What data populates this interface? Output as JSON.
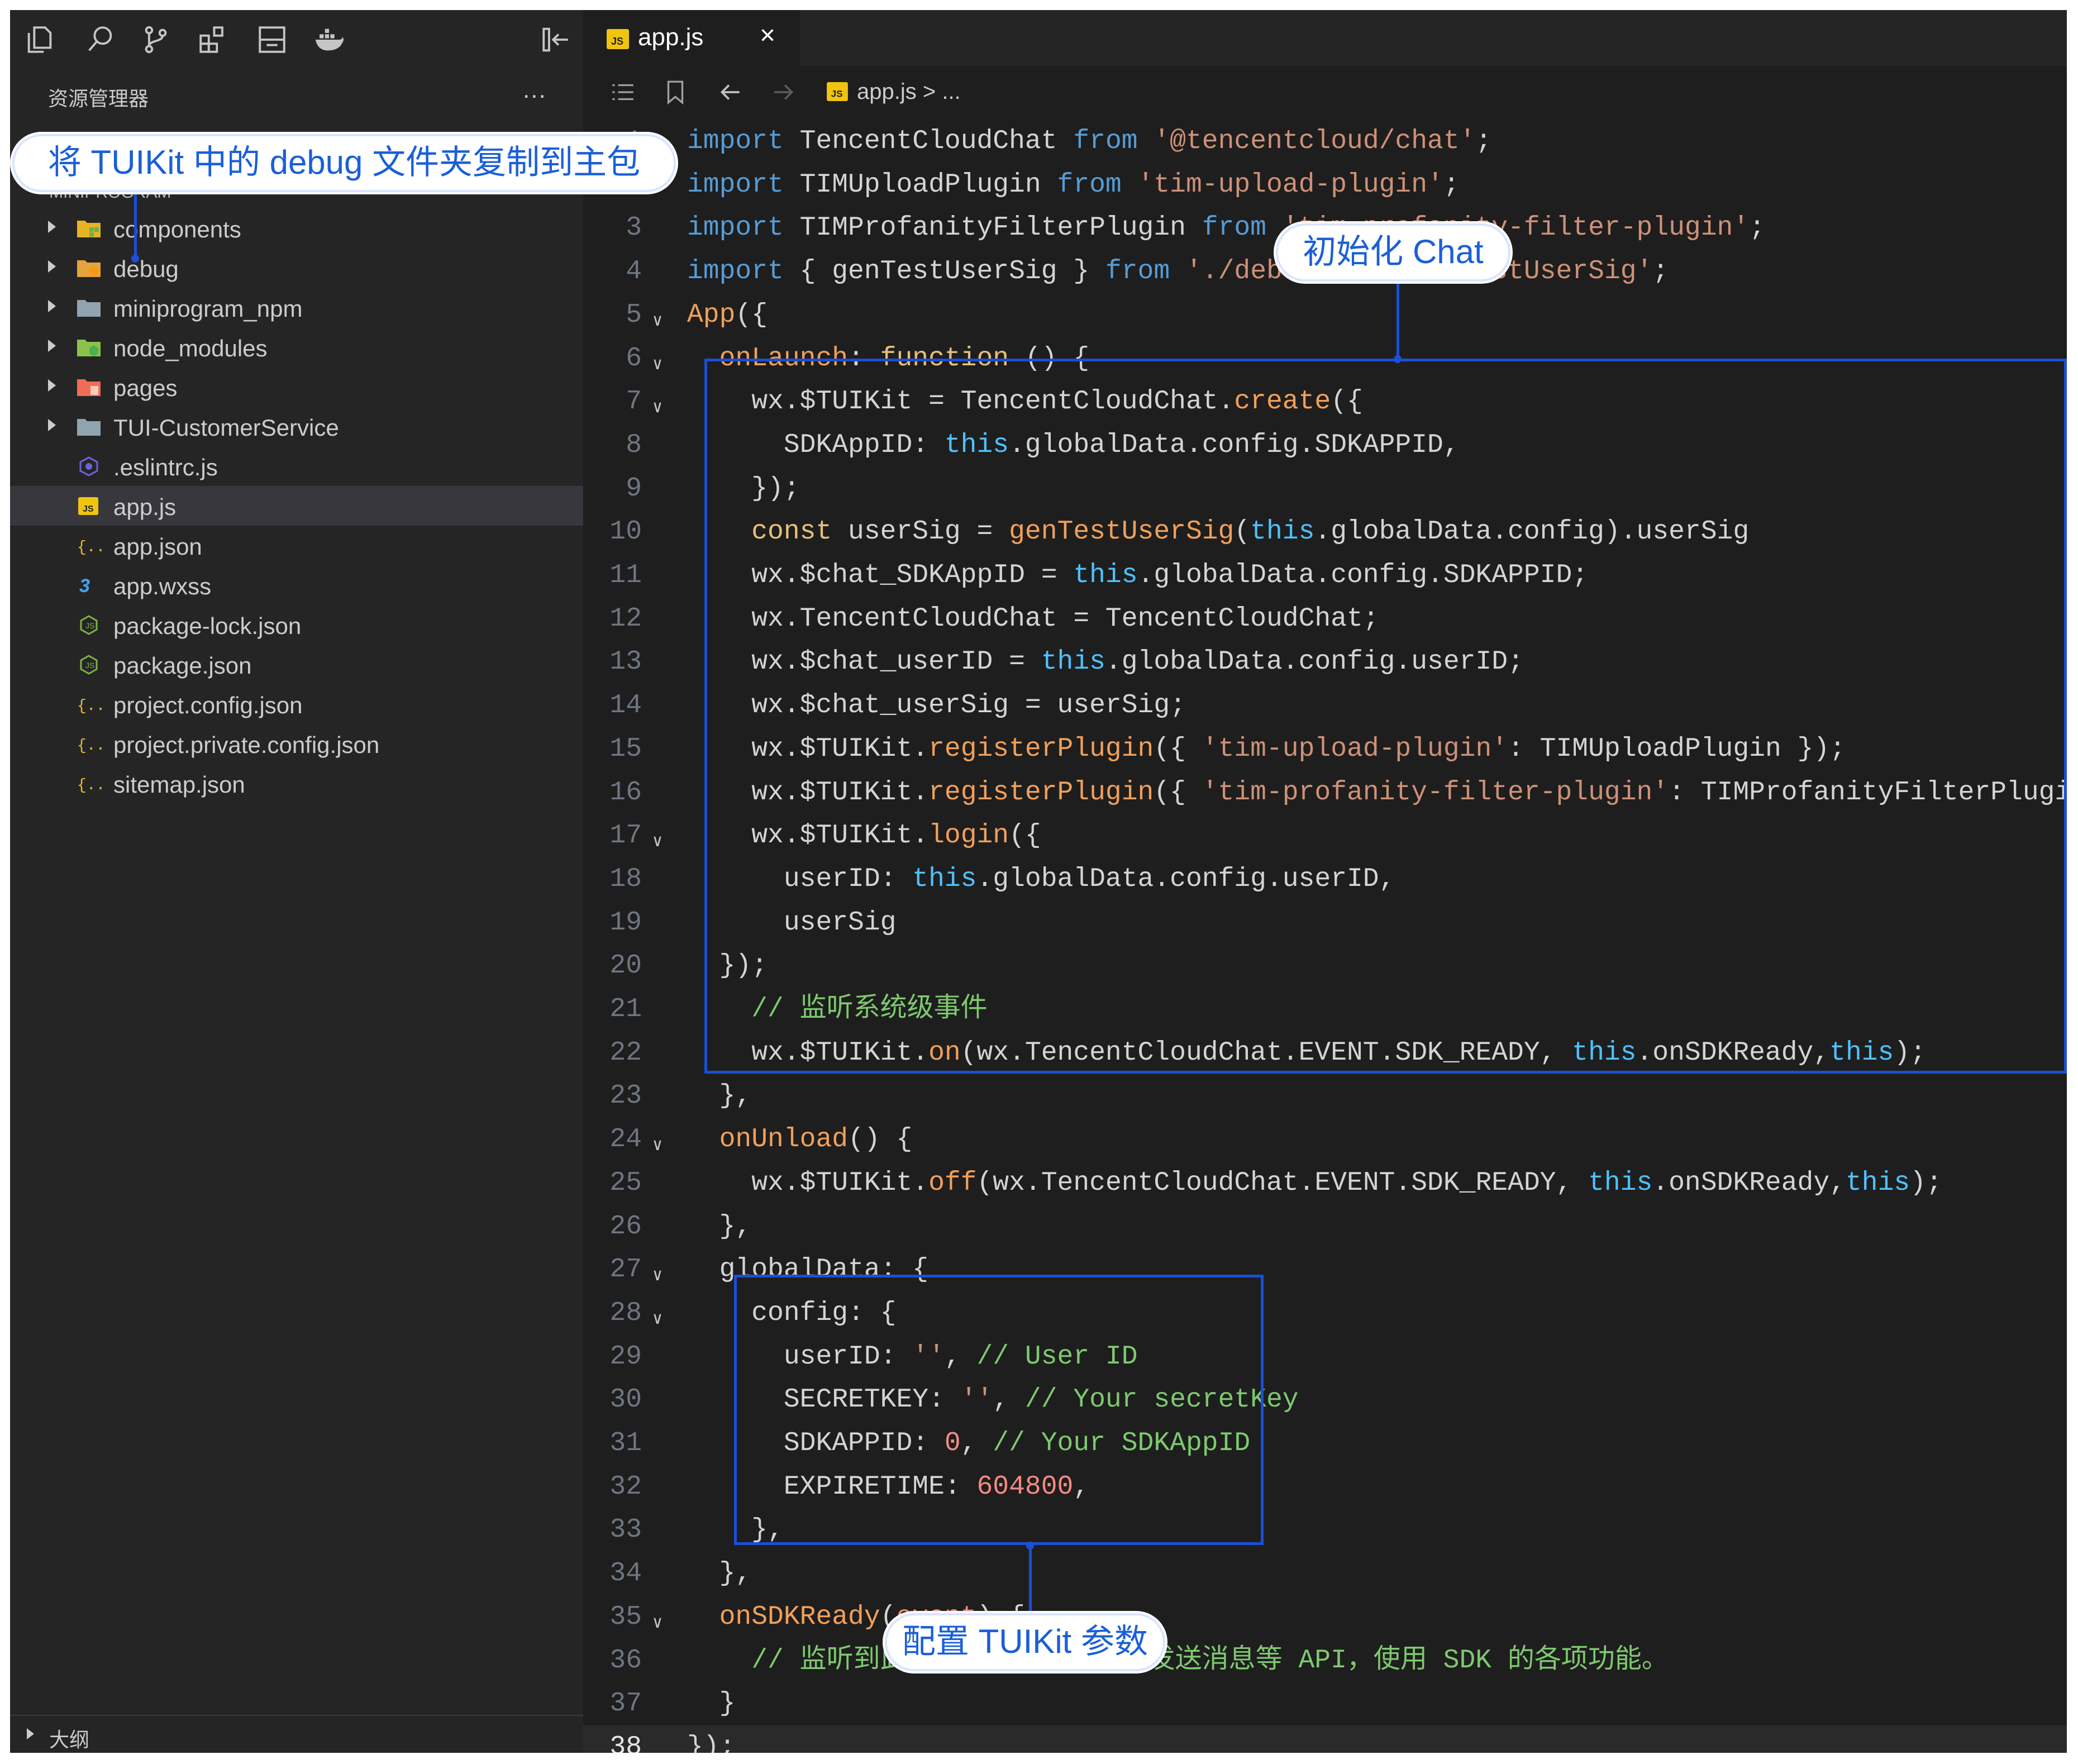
{
  "activity_icons": [
    "files-icon",
    "search-icon",
    "source-control-icon",
    "extensions-icon",
    "panel-icon",
    "docker-icon",
    "collapse-panel-icon"
  ],
  "explorer": {
    "title": "资源管理器",
    "more": "...",
    "section": "MINIPROGRAM",
    "items": [
      {
        "label": "components",
        "type": "folder",
        "icon": "components-folder-icon",
        "expandable": true
      },
      {
        "label": "debug",
        "type": "folder",
        "icon": "debug-folder-icon",
        "expandable": true
      },
      {
        "label": "miniprogram_npm",
        "type": "folder",
        "icon": "folder-icon",
        "expandable": true
      },
      {
        "label": "node_modules",
        "type": "folder",
        "icon": "node-folder-icon",
        "expandable": true
      },
      {
        "label": "pages",
        "type": "folder",
        "icon": "pages-folder-icon",
        "expandable": true
      },
      {
        "label": "TUI-CustomerService",
        "type": "folder",
        "icon": "folder-icon",
        "expandable": true
      },
      {
        "label": ".eslintrc.js",
        "type": "file",
        "icon": "eslint-icon"
      },
      {
        "label": "app.js",
        "type": "file",
        "icon": "js-file-icon",
        "active": true
      },
      {
        "label": "app.json",
        "type": "file",
        "icon": "json-icon"
      },
      {
        "label": "app.wxss",
        "type": "file",
        "icon": "css-icon"
      },
      {
        "label": "package-lock.json",
        "type": "file",
        "icon": "npm-icon"
      },
      {
        "label": "package.json",
        "type": "file",
        "icon": "npm-icon"
      },
      {
        "label": "project.config.json",
        "type": "file",
        "icon": "json-icon"
      },
      {
        "label": "project.private.config.json",
        "type": "file",
        "icon": "json-icon"
      },
      {
        "label": "sitemap.json",
        "type": "file",
        "icon": "json-icon"
      }
    ],
    "outline": "大纲"
  },
  "tab": {
    "label": "app.js",
    "close": "×",
    "badge": "JS"
  },
  "breadcrumb": {
    "file": "app.js",
    "rest": " > ..."
  },
  "code": [
    {
      "n": "1",
      "fold": true,
      "t": [
        [
          "kw2",
          "import "
        ],
        [
          "id",
          "TencentCloudChat "
        ],
        [
          "kw2",
          "from "
        ],
        [
          "str",
          "'@tencentcloud/chat'"
        ],
        [
          "w",
          ";"
        ]
      ]
    },
    {
      "n": "2",
      "fold": false,
      "t": [
        [
          "kw2",
          "import "
        ],
        [
          "id",
          "TIMUploadPlugin "
        ],
        [
          "kw2",
          "from "
        ],
        [
          "str",
          "'tim-upload-plugin'"
        ],
        [
          "w",
          ";"
        ]
      ]
    },
    {
      "n": "3",
      "fold": false,
      "t": [
        [
          "kw2",
          "import "
        ],
        [
          "id",
          "TIMProfanityFilterPlugin "
        ],
        [
          "kw2",
          "from "
        ],
        [
          "str",
          "'tim-profanity-filter-plugin'"
        ],
        [
          "w",
          ";"
        ]
      ]
    },
    {
      "n": "4",
      "fold": false,
      "t": [
        [
          "kw2",
          "import "
        ],
        [
          "w",
          "{ "
        ],
        [
          "id",
          "genTestUserSig "
        ],
        [
          "w",
          "} "
        ],
        [
          "kw2",
          "from "
        ],
        [
          "str",
          "'./debug/GenerateTestUserSig'"
        ],
        [
          "w",
          ";"
        ]
      ]
    },
    {
      "n": "5",
      "fold": true,
      "t": [
        [
          "o",
          "App"
        ],
        [
          "w",
          "({"
        ]
      ]
    },
    {
      "n": "6",
      "fold": true,
      "t": [
        [
          "w",
          "  "
        ],
        [
          "o",
          "onLaunch"
        ],
        [
          "w",
          ": "
        ],
        [
          "y",
          "function "
        ],
        [
          "w",
          "() {"
        ]
      ]
    },
    {
      "n": "7",
      "fold": true,
      "t": [
        [
          "w",
          "    wx.$TUIKit = TencentCloudChat."
        ],
        [
          "o",
          "create"
        ],
        [
          "w",
          "({"
        ]
      ]
    },
    {
      "n": "8",
      "fold": false,
      "t": [
        [
          "w",
          "      SDKAppID: "
        ],
        [
          "th",
          "this"
        ],
        [
          "w",
          ".globalData.config.SDKAPPID,"
        ]
      ]
    },
    {
      "n": "9",
      "fold": false,
      "t": [
        [
          "w",
          "    });"
        ]
      ]
    },
    {
      "n": "10",
      "fold": false,
      "t": [
        [
          "w",
          "    "
        ],
        [
          "y",
          "const "
        ],
        [
          "w",
          "userSig = "
        ],
        [
          "o",
          "genTestUserSig"
        ],
        [
          "w",
          "("
        ],
        [
          "th",
          "this"
        ],
        [
          "w",
          ".globalData.config).userSig"
        ]
      ]
    },
    {
      "n": "11",
      "fold": false,
      "t": [
        [
          "w",
          "    wx.$chat_SDKAppID = "
        ],
        [
          "th",
          "this"
        ],
        [
          "w",
          ".globalData.config.SDKAPPID;"
        ]
      ]
    },
    {
      "n": "12",
      "fold": false,
      "t": [
        [
          "w",
          "    wx.TencentCloudChat = TencentCloudChat;"
        ]
      ]
    },
    {
      "n": "13",
      "fold": false,
      "t": [
        [
          "w",
          "    wx.$chat_userID = "
        ],
        [
          "th",
          "this"
        ],
        [
          "w",
          ".globalData.config.userID;"
        ]
      ]
    },
    {
      "n": "14",
      "fold": false,
      "t": [
        [
          "w",
          "    wx.$chat_userSig = userSig;"
        ]
      ]
    },
    {
      "n": "15",
      "fold": false,
      "t": [
        [
          "w",
          "    wx.$TUIKit."
        ],
        [
          "o",
          "registerPlugin"
        ],
        [
          "w",
          "({ "
        ],
        [
          "str",
          "'tim-upload-plugin'"
        ],
        [
          "w",
          ": TIMUploadPlugin });"
        ]
      ]
    },
    {
      "n": "16",
      "fold": false,
      "t": [
        [
          "w",
          "    wx.$TUIKit."
        ],
        [
          "o",
          "registerPlugin"
        ],
        [
          "w",
          "({ "
        ],
        [
          "str",
          "'tim-profanity-filter-plugin'"
        ],
        [
          "w",
          ": TIMProfanityFilterPlugin });"
        ]
      ]
    },
    {
      "n": "17",
      "fold": true,
      "t": [
        [
          "w",
          "    wx.$TUIKit."
        ],
        [
          "o",
          "login"
        ],
        [
          "w",
          "({"
        ]
      ]
    },
    {
      "n": "18",
      "fold": false,
      "t": [
        [
          "w",
          "      userID: "
        ],
        [
          "th",
          "this"
        ],
        [
          "w",
          ".globalData.config.userID,"
        ]
      ]
    },
    {
      "n": "19",
      "fold": false,
      "t": [
        [
          "w",
          "      userSig"
        ]
      ]
    },
    {
      "n": "20",
      "fold": false,
      "t": [
        [
          "w",
          "  });"
        ]
      ]
    },
    {
      "n": "21",
      "fold": false,
      "t": [
        [
          "w",
          "    "
        ],
        [
          "g",
          "// 监听系统级事件"
        ]
      ]
    },
    {
      "n": "22",
      "fold": false,
      "t": [
        [
          "w",
          "    wx.$TUIKit."
        ],
        [
          "o",
          "on"
        ],
        [
          "w",
          "(wx.TencentCloudChat.EVENT.SDK_READY, "
        ],
        [
          "th",
          "this"
        ],
        [
          "w",
          ".onSDKReady,"
        ],
        [
          "th",
          "this"
        ],
        [
          "w",
          ");"
        ]
      ]
    },
    {
      "n": "23",
      "fold": false,
      "t": [
        [
          "w",
          "  },"
        ]
      ]
    },
    {
      "n": "24",
      "fold": true,
      "t": [
        [
          "w",
          "  "
        ],
        [
          "o",
          "onUnload"
        ],
        [
          "w",
          "() {"
        ]
      ]
    },
    {
      "n": "25",
      "fold": false,
      "t": [
        [
          "w",
          "    wx.$TUIKit."
        ],
        [
          "o",
          "off"
        ],
        [
          "w",
          "(wx.TencentCloudChat.EVENT.SDK_READY, "
        ],
        [
          "th",
          "this"
        ],
        [
          "w",
          ".onSDKReady,"
        ],
        [
          "th",
          "this"
        ],
        [
          "w",
          ");"
        ]
      ]
    },
    {
      "n": "26",
      "fold": false,
      "t": [
        [
          "w",
          "  },"
        ]
      ]
    },
    {
      "n": "27",
      "fold": true,
      "t": [
        [
          "w",
          "  globalData: {"
        ]
      ]
    },
    {
      "n": "28",
      "fold": true,
      "t": [
        [
          "w",
          "    config: {"
        ]
      ]
    },
    {
      "n": "29",
      "fold": false,
      "t": [
        [
          "w",
          "      userID: "
        ],
        [
          "str",
          "''"
        ],
        [
          "w",
          ", "
        ],
        [
          "g",
          "// User ID"
        ]
      ]
    },
    {
      "n": "30",
      "fold": false,
      "t": [
        [
          "w",
          "      SECRETKEY: "
        ],
        [
          "str",
          "''"
        ],
        [
          "w",
          ", "
        ],
        [
          "g",
          "// Your secretKey"
        ]
      ]
    },
    {
      "n": "31",
      "fold": false,
      "t": [
        [
          "w",
          "      SDKAPPID: "
        ],
        [
          "st",
          "0"
        ],
        [
          "w",
          ", "
        ],
        [
          "g",
          "// Your SDKAppID"
        ]
      ]
    },
    {
      "n": "32",
      "fold": false,
      "t": [
        [
          "w",
          "      EXPIRETIME: "
        ],
        [
          "st",
          "604800"
        ],
        [
          "w",
          ","
        ]
      ]
    },
    {
      "n": "33",
      "fold": false,
      "t": [
        [
          "w",
          "    },"
        ]
      ]
    },
    {
      "n": "34",
      "fold": false,
      "t": [
        [
          "w",
          "  },"
        ]
      ]
    },
    {
      "n": "35",
      "fold": true,
      "t": [
        [
          "w",
          "  "
        ],
        [
          "o",
          "onSDKReady"
        ],
        [
          "w",
          "("
        ],
        [
          "st",
          "event"
        ],
        [
          "w",
          ") {"
        ]
      ]
    },
    {
      "n": "36",
      "fold": false,
      "t": [
        [
          "w",
          "    "
        ],
        [
          "g",
          "// 监听到此事件后可调用 SDK 发送消息等 API，使用 SDK 的各项功能。"
        ]
      ]
    },
    {
      "n": "37",
      "fold": false,
      "t": [
        [
          "w",
          "  }"
        ]
      ]
    },
    {
      "n": "38",
      "fold": false,
      "t": [
        [
          "w",
          "});"
        ]
      ]
    }
  ],
  "callouts": {
    "copy_debug": "将 TUIKit 中的 debug 文件夹复制到主包",
    "init_chat": "初始化 Chat",
    "config_params": "配置 TUIKit 参数"
  },
  "colors": {
    "highlight": "#1b4fd8",
    "callout_text": "#1b5fd8"
  }
}
